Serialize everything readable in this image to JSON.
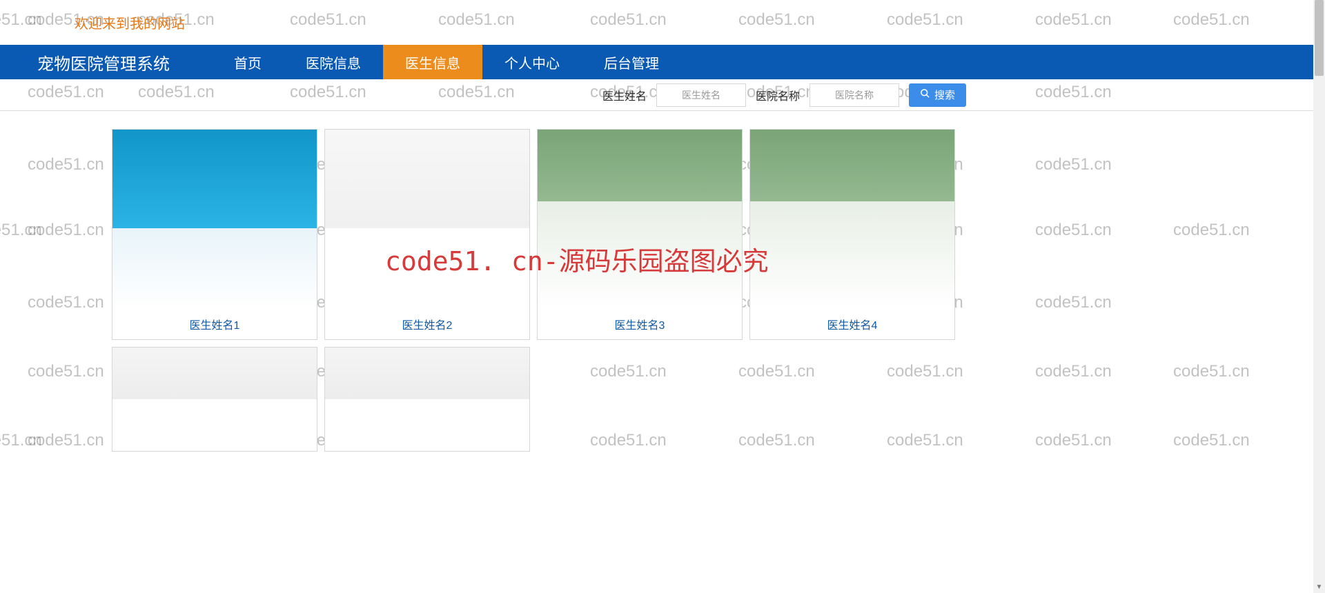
{
  "welcome_text": "欢迎来到我的网站",
  "site_title": "宠物医院管理系统",
  "nav": {
    "items": [
      {
        "label": "首页",
        "active": false
      },
      {
        "label": "医院信息",
        "active": false
      },
      {
        "label": "医生信息",
        "active": true
      },
      {
        "label": "个人中心",
        "active": false
      },
      {
        "label": "后台管理",
        "active": false
      }
    ]
  },
  "search": {
    "field1_label": "医生姓名",
    "field1_placeholder": "医生姓名",
    "field2_label": "医院名称",
    "field2_placeholder": "医院名称",
    "button_label": "搜索"
  },
  "doctors": [
    {
      "name": "医生姓名1"
    },
    {
      "name": "医生姓名2"
    },
    {
      "name": "医生姓名3"
    },
    {
      "name": "医生姓名4"
    },
    {
      "name": ""
    },
    {
      "name": ""
    }
  ],
  "watermark_text": "code51.cn",
  "big_watermark_text": "code51. cn-源码乐园盗图必究"
}
